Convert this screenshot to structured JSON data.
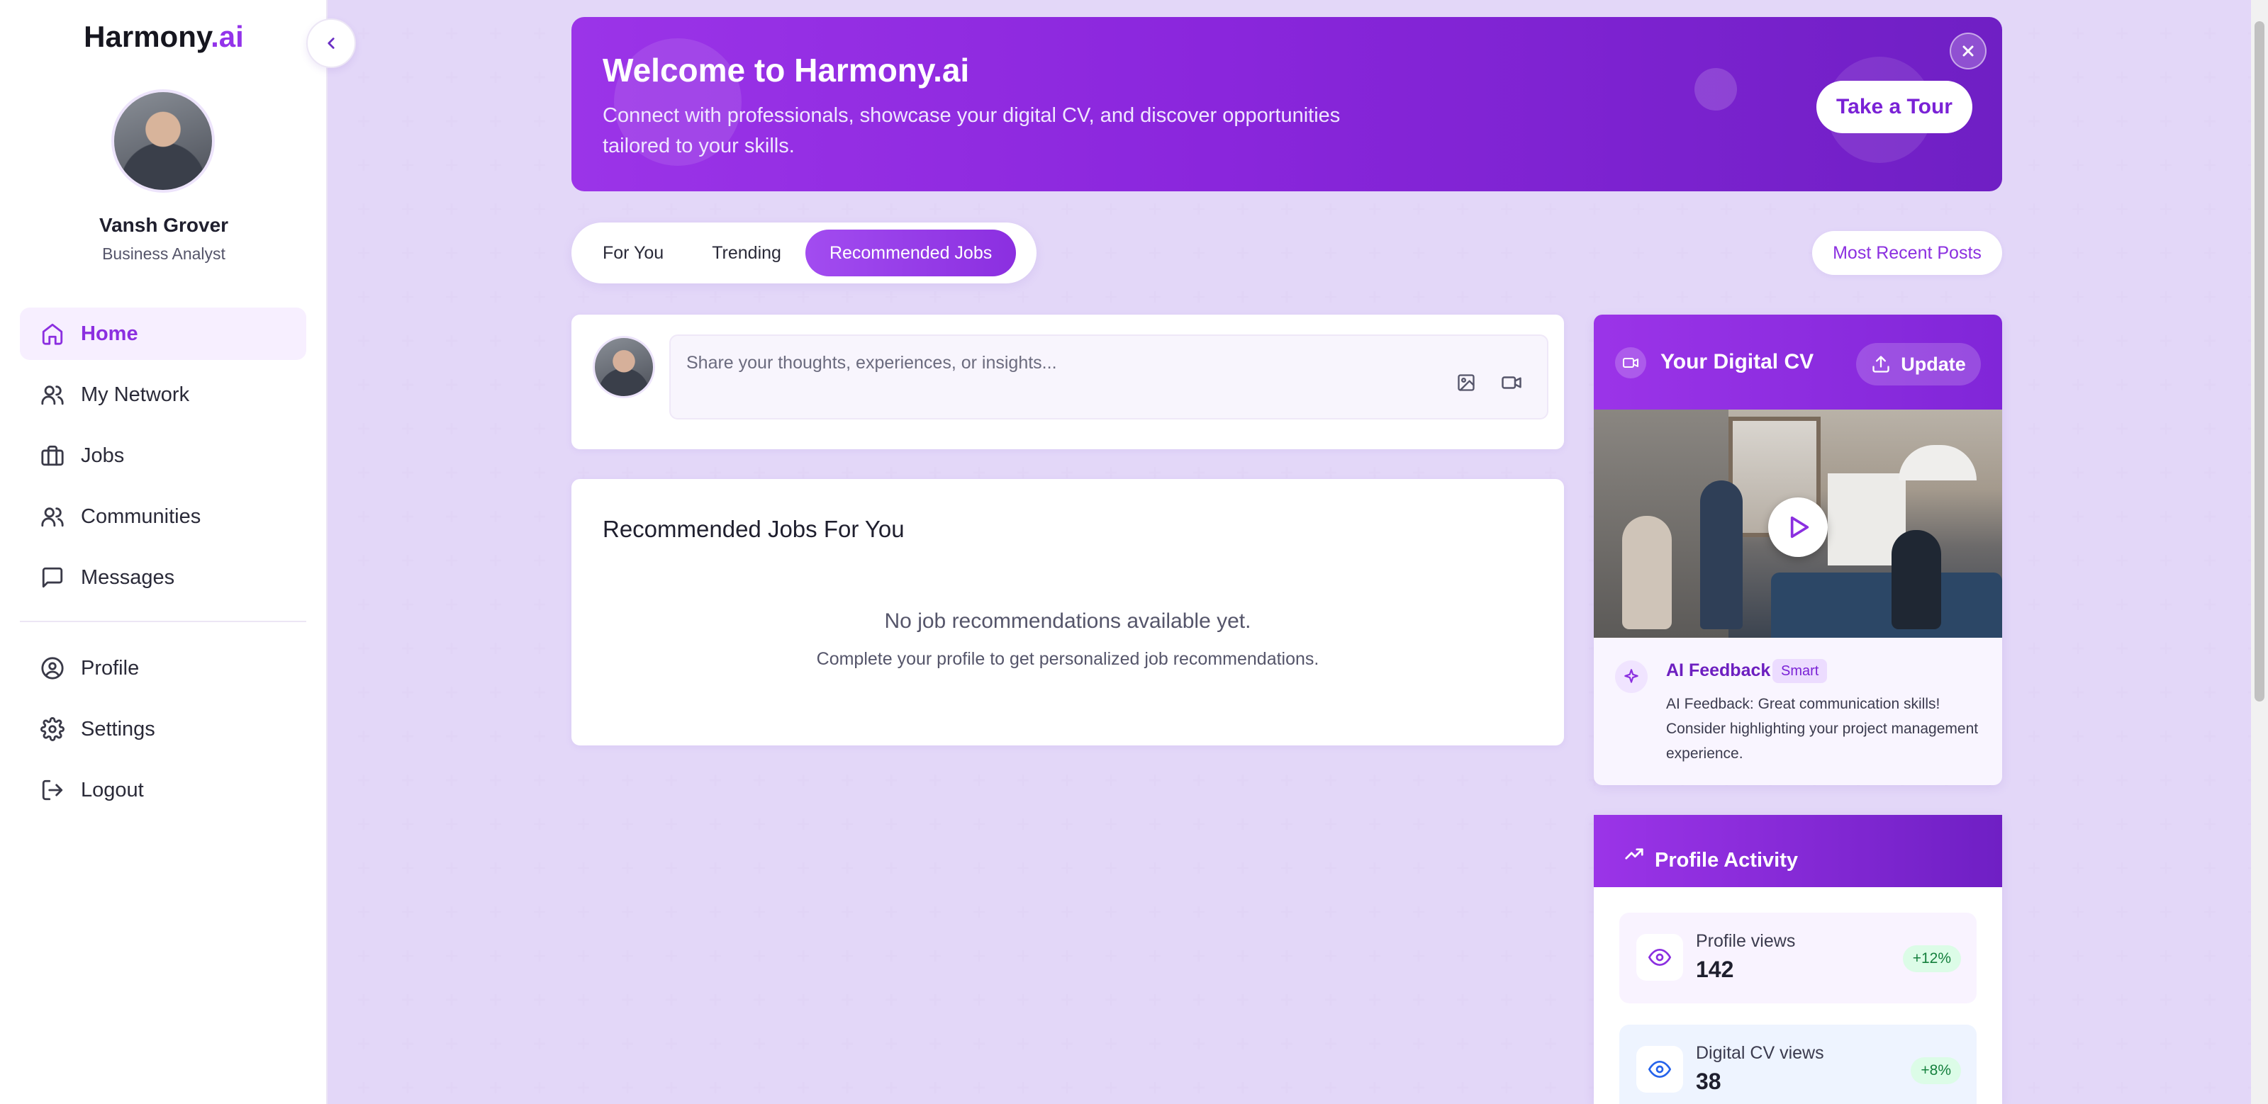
{
  "app": {
    "logo_main": "Harmony",
    "logo_accent": ".ai"
  },
  "user": {
    "name": "Vansh Grover",
    "role": "Business Analyst"
  },
  "nav": {
    "primary": [
      {
        "label": "Home",
        "icon": "home-icon",
        "active": true
      },
      {
        "label": "My Network",
        "icon": "users-icon"
      },
      {
        "label": "Jobs",
        "icon": "briefcase-icon"
      },
      {
        "label": "Communities",
        "icon": "users-icon"
      },
      {
        "label": "Messages",
        "icon": "message-icon"
      }
    ],
    "secondary": [
      {
        "label": "Profile",
        "icon": "user-circle-icon"
      },
      {
        "label": "Settings",
        "icon": "gear-icon"
      },
      {
        "label": "Logout",
        "icon": "logout-icon"
      }
    ]
  },
  "banner": {
    "title": "Welcome to Harmony.ai",
    "subtitle": "Connect with professionals, showcase your digital CV, and discover opportunities tailored to your skills.",
    "tour_button": "Take a Tour"
  },
  "tabs": [
    {
      "label": "For You",
      "active": false
    },
    {
      "label": "Trending",
      "active": false
    },
    {
      "label": "Recommended Jobs",
      "active": true
    }
  ],
  "sort_button": "Most Recent Posts",
  "composer": {
    "placeholder": "Share your thoughts, experiences, or insights..."
  },
  "jobs": {
    "title": "Recommended Jobs For You",
    "empty": "No job recommendations available yet.",
    "hint": "Complete your profile to get personalized job recommendations."
  },
  "digital_cv": {
    "title": "Your Digital CV",
    "update_button": "Update",
    "ai_title": "AI Feedback",
    "ai_badge": "Smart",
    "ai_text": "AI Feedback: Great communication skills! Consider highlighting your project management experience."
  },
  "activity": {
    "title": "Profile Activity",
    "stats": [
      {
        "label": "Profile views",
        "value": "142",
        "change": "+12%"
      },
      {
        "label": "Digital CV views",
        "value": "38",
        "change": "+8%"
      }
    ]
  },
  "colors": {
    "accent": "#9333ea",
    "accent_dark": "#6f1fc4",
    "page_bg": "#f7f3fd",
    "success": "#15803d"
  }
}
